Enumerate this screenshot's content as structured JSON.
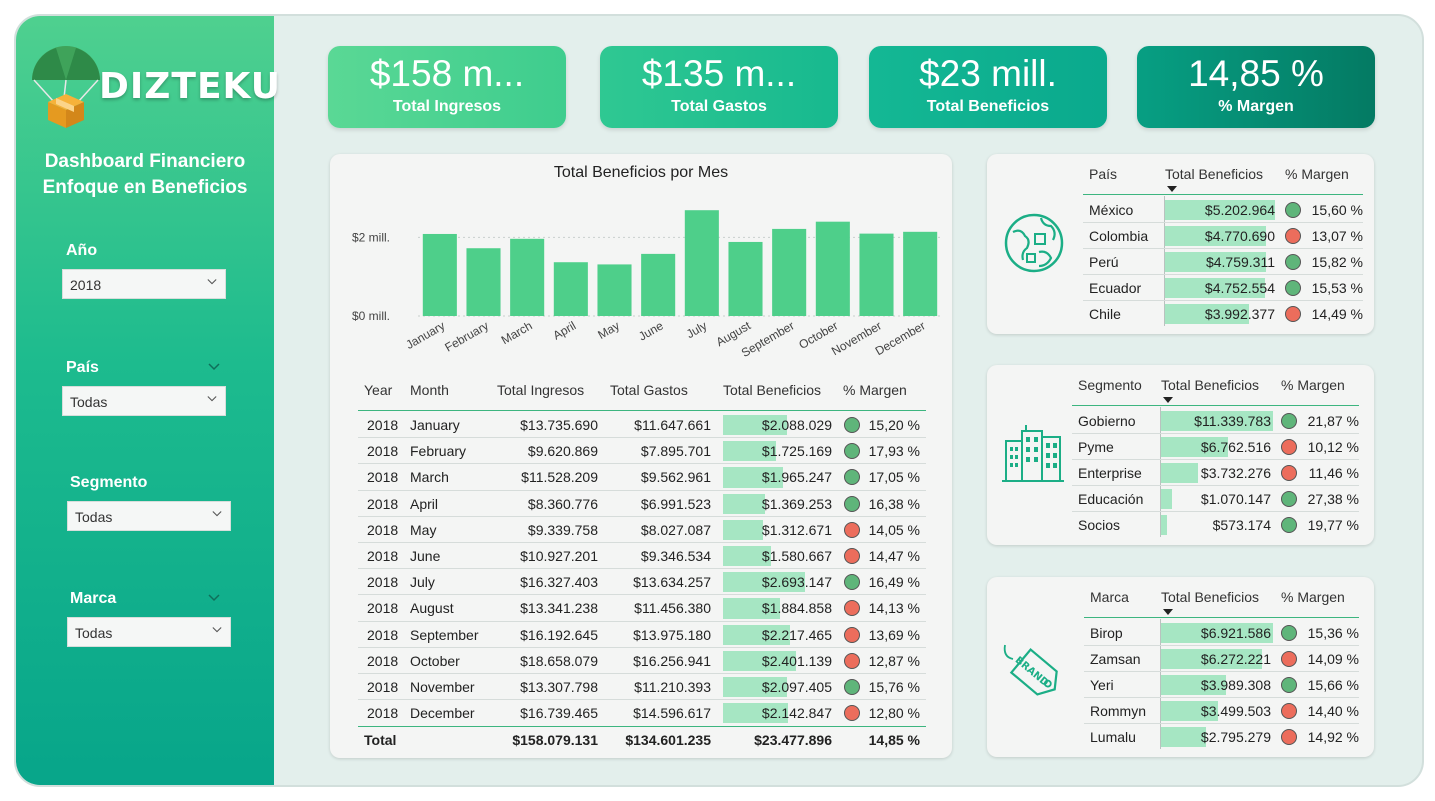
{
  "brand": {
    "name": "DIZTEKU"
  },
  "sidebar": {
    "title_line1": "Dashboard Financiero",
    "title_line2": "Enfoque en Beneficios",
    "filters": [
      {
        "label": "Año",
        "value": "2018"
      },
      {
        "label": "País",
        "value": "Todas"
      },
      {
        "label": "Segmento",
        "value": "Todas"
      },
      {
        "label": "Marca",
        "value": "Todas"
      }
    ]
  },
  "kpis": [
    {
      "value": "$158 m...",
      "label": "Total Ingresos"
    },
    {
      "value": "$135 m...",
      "label": "Total Gastos"
    },
    {
      "value": "$23 mill.",
      "label": "Total Beneficios"
    },
    {
      "value": "14,85 %",
      "label": "% Margen"
    }
  ],
  "chart_data": {
    "type": "bar",
    "title": "Total Beneficios por Mes",
    "categories": [
      "January",
      "February",
      "March",
      "April",
      "May",
      "June",
      "July",
      "August",
      "September",
      "October",
      "November",
      "December"
    ],
    "values": [
      2.088,
      1.725,
      1.965,
      1.369,
      1.313,
      1.581,
      2.693,
      1.885,
      2.217,
      2.401,
      2.097,
      2.143
    ],
    "yticks": [
      "$0 mill.",
      "$2 mill."
    ],
    "ylim": [
      0,
      2.8
    ],
    "color": "#4ecf8a",
    "grid": true
  },
  "month_table": {
    "headers": [
      "Year",
      "Month",
      "Total Ingresos",
      "Total Gastos",
      "Total Beneficios",
      "% Margen"
    ],
    "rows": [
      {
        "year": "2018",
        "month": "January",
        "ingresos": "$13.735.690",
        "gastos": "$11.647.661",
        "beneficios": "$2.088.029",
        "bar": 0.775,
        "status": "g",
        "margen": "15,20 %"
      },
      {
        "year": "2018",
        "month": "February",
        "ingresos": "$9.620.869",
        "gastos": "$7.895.701",
        "beneficios": "$1.725.169",
        "bar": 0.641,
        "status": "g",
        "margen": "17,93 %"
      },
      {
        "year": "2018",
        "month": "March",
        "ingresos": "$11.528.209",
        "gastos": "$9.562.961",
        "beneficios": "$1.965.247",
        "bar": 0.73,
        "status": "g",
        "margen": "17,05 %"
      },
      {
        "year": "2018",
        "month": "April",
        "ingresos": "$8.360.776",
        "gastos": "$6.991.523",
        "beneficios": "$1.369.253",
        "bar": 0.508,
        "status": "g",
        "margen": "16,38 %"
      },
      {
        "year": "2018",
        "month": "May",
        "ingresos": "$9.339.758",
        "gastos": "$8.027.087",
        "beneficios": "$1.312.671",
        "bar": 0.487,
        "status": "r",
        "margen": "14,05 %"
      },
      {
        "year": "2018",
        "month": "June",
        "ingresos": "$10.927.201",
        "gastos": "$9.346.534",
        "beneficios": "$1.580.667",
        "bar": 0.587,
        "status": "r",
        "margen": "14,47 %"
      },
      {
        "year": "2018",
        "month": "July",
        "ingresos": "$16.327.403",
        "gastos": "$13.634.257",
        "beneficios": "$2.693.147",
        "bar": 1.0,
        "status": "g",
        "margen": "16,49 %"
      },
      {
        "year": "2018",
        "month": "August",
        "ingresos": "$13.341.238",
        "gastos": "$11.456.380",
        "beneficios": "$1.884.858",
        "bar": 0.7,
        "status": "r",
        "margen": "14,13 %"
      },
      {
        "year": "2018",
        "month": "September",
        "ingresos": "$16.192.645",
        "gastos": "$13.975.180",
        "beneficios": "$2.217.465",
        "bar": 0.823,
        "status": "r",
        "margen": "13,69 %"
      },
      {
        "year": "2018",
        "month": "October",
        "ingresos": "$18.658.079",
        "gastos": "$16.256.941",
        "beneficios": "$2.401.139",
        "bar": 0.892,
        "status": "r",
        "margen": "12,87 %"
      },
      {
        "year": "2018",
        "month": "November",
        "ingresos": "$13.307.798",
        "gastos": "$11.210.393",
        "beneficios": "$2.097.405",
        "bar": 0.779,
        "status": "g",
        "margen": "15,76 %"
      },
      {
        "year": "2018",
        "month": "December",
        "ingresos": "$16.739.465",
        "gastos": "$14.596.617",
        "beneficios": "$2.142.847",
        "bar": 0.796,
        "status": "r",
        "margen": "12,80 %"
      }
    ],
    "total": {
      "label": "Total",
      "ingresos": "$158.079.131",
      "gastos": "$134.601.235",
      "beneficios": "$23.477.896",
      "margen": "14,85 %"
    }
  },
  "country_table": {
    "icon": "globe-icon",
    "headers": [
      "País",
      "Total Beneficios",
      "% Margen"
    ],
    "rows": [
      {
        "name": "México",
        "value": "$5.202.964",
        "bar": 1.0,
        "status": "g",
        "margen": "15,60 %"
      },
      {
        "name": "Colombia",
        "value": "$4.770.690",
        "bar": 0.917,
        "status": "r",
        "margen": "13,07 %"
      },
      {
        "name": "Perú",
        "value": "$4.759.311",
        "bar": 0.915,
        "status": "g",
        "margen": "15,82 %"
      },
      {
        "name": "Ecuador",
        "value": "$4.752.554",
        "bar": 0.913,
        "status": "g",
        "margen": "15,53 %"
      },
      {
        "name": "Chile",
        "value": "$3.992.377",
        "bar": 0.767,
        "status": "r",
        "margen": "14,49 %"
      }
    ]
  },
  "segment_table": {
    "icon": "buildings-icon",
    "headers": [
      "Segmento",
      "Total Beneficios",
      "% Margen"
    ],
    "rows": [
      {
        "name": "Gobierno",
        "value": "$11.339.783",
        "bar": 1.0,
        "status": "g",
        "margen": "21,87 %"
      },
      {
        "name": "Pyme",
        "value": "$6.762.516",
        "bar": 0.596,
        "status": "r",
        "margen": "10,12 %"
      },
      {
        "name": "Enterprise",
        "value": "$3.732.276",
        "bar": 0.329,
        "status": "r",
        "margen": "11,46 %"
      },
      {
        "name": "Educación",
        "value": "$1.070.147",
        "bar": 0.094,
        "status": "g",
        "margen": "27,38 %"
      },
      {
        "name": "Socios",
        "value": "$573.174",
        "bar": 0.051,
        "status": "g",
        "margen": "19,77 %"
      }
    ]
  },
  "brand_table": {
    "icon": "brand-tag-icon",
    "icon_text": "BRAND",
    "headers": [
      "Marca",
      "Total Beneficios",
      "% Margen"
    ],
    "rows": [
      {
        "name": "Birop",
        "value": "$6.921.586",
        "bar": 1.0,
        "status": "g",
        "margen": "15,36 %"
      },
      {
        "name": "Zamsan",
        "value": "$6.272.221",
        "bar": 0.906,
        "status": "r",
        "margen": "14,09 %"
      },
      {
        "name": "Yeri",
        "value": "$3.989.308",
        "bar": 0.576,
        "status": "g",
        "margen": "15,66 %"
      },
      {
        "name": "Rommyn",
        "value": "$3.499.503",
        "bar": 0.506,
        "status": "r",
        "margen": "14,40 %"
      },
      {
        "name": "Lumalu",
        "value": "$2.795.279",
        "bar": 0.404,
        "status": "r",
        "margen": "14,92 %"
      }
    ]
  }
}
